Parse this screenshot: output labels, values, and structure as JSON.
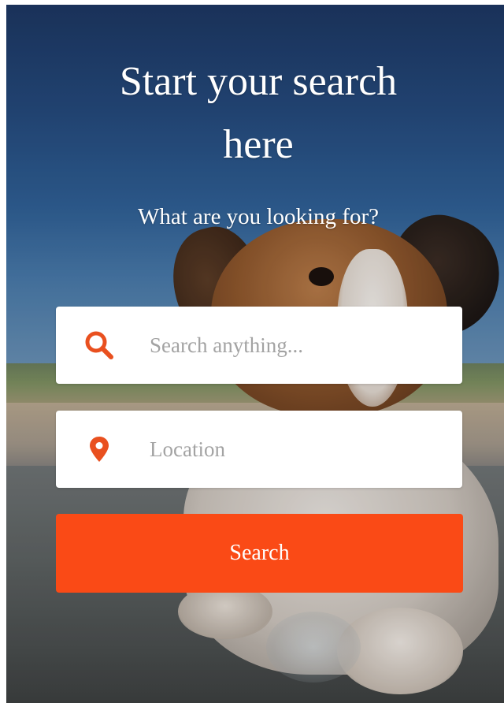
{
  "hero": {
    "title_line1": "Start your search",
    "title_line2": "here",
    "subtitle": "What are you looking for?"
  },
  "search_field": {
    "placeholder": "Search anything...",
    "value": "",
    "icon": "search-icon"
  },
  "location_field": {
    "placeholder": "Location",
    "value": "",
    "icon": "map-pin-icon"
  },
  "search_button": {
    "label": "Search"
  },
  "colors": {
    "accent": "#fa4a16",
    "icon": "#e9501f",
    "field_background": "#ffffff",
    "placeholder_text": "#a3a3a3",
    "heading_text": "#ffffff"
  },
  "background": {
    "image": "dog-running-on-beach-photo"
  }
}
